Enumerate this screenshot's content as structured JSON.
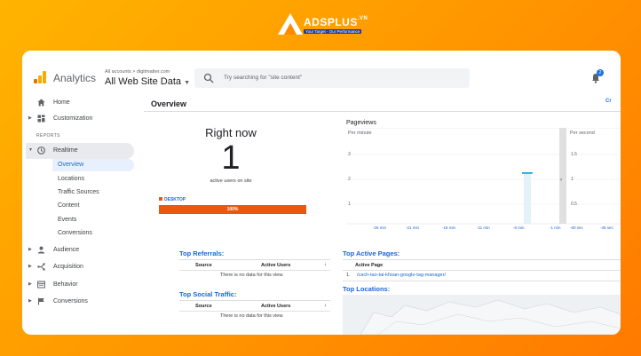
{
  "brand": {
    "name": "ADSPLUS",
    "suffix": ".VN",
    "tagline": "Your Target - Our Performance"
  },
  "header": {
    "app_name": "Analytics",
    "breadcrumb": "All accounts > digitmatter.com",
    "property": "All Web Site Data",
    "search_placeholder": "Try searching for \"site content\"",
    "notification_count": "2"
  },
  "sidebar": {
    "top_items": [
      {
        "label": "Home",
        "icon": "home-icon"
      },
      {
        "label": "Customization",
        "icon": "dashboard-icon"
      }
    ],
    "section_label": "REPORTS",
    "realtime": {
      "label": "Realtime",
      "icon": "clock-icon"
    },
    "realtime_sub": [
      "Overview",
      "Locations",
      "Traffic Sources",
      "Content",
      "Events",
      "Conversions"
    ],
    "report_items": [
      {
        "label": "Audience",
        "icon": "person-icon"
      },
      {
        "label": "Acquisition",
        "icon": "acquisition-icon"
      },
      {
        "label": "Behavior",
        "icon": "behavior-icon"
      },
      {
        "label": "Conversions",
        "icon": "flag-icon"
      }
    ]
  },
  "main": {
    "title": "Overview",
    "corner_link": "Cr",
    "right_now": {
      "title": "Right now",
      "value": "1",
      "subtitle": "active users on site",
      "device_label": "DESKTOP",
      "device_percent": "100%"
    },
    "pageviews": {
      "title": "Pageviews",
      "per_minute": "Per minute",
      "per_second": "Per second",
      "y_ticks_min": [
        "3",
        "2",
        "1"
      ],
      "y_ticks_sec": [
        "1.5",
        "1",
        "0.5"
      ],
      "x_ticks_min": [
        "-26 min",
        "-21 min",
        "-16 min",
        "-11 min",
        "-6 min",
        "-1 min"
      ],
      "x_ticks_sec": [
        "-60 sec",
        "-45 sec"
      ]
    },
    "top_referrals": {
      "title": "Top Referrals:",
      "col_source": "Source",
      "col_active": "Active Users",
      "empty": "There is no data for this view."
    },
    "top_social": {
      "title": "Top Social Traffic:",
      "col_source": "Source",
      "col_active": "Active Users",
      "empty": "There is no data for this view."
    },
    "top_pages": {
      "title": "Top Active Pages:",
      "col_page": "Active Page",
      "rows": [
        {
          "index": "1.",
          "page": "/cach-tao-tai-khoan-google-tag-manager/"
        }
      ]
    },
    "top_locations": {
      "title": "Top Locations:"
    }
  },
  "colors": {
    "accent": "#1a73e8",
    "device_bar": "#e8590c",
    "chart_bar": "#29a3d6",
    "chart_shade": "#e3f1f8"
  }
}
